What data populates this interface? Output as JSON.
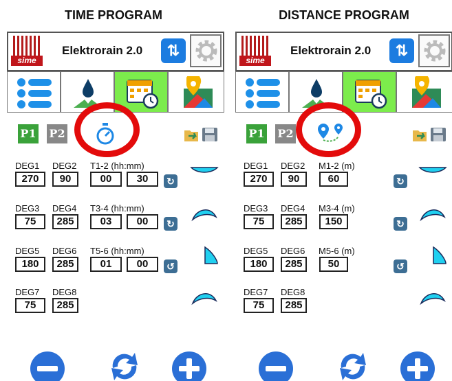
{
  "headings": {
    "left": "TIME PROGRAM",
    "right": "DISTANCE PROGRAM"
  },
  "panels": [
    {
      "app_title": "Elektrorain 2.0",
      "logo_text": "sime",
      "program_buttons": [
        "P1",
        "P2"
      ],
      "mode_icon": "stopwatch-icon",
      "rows": [
        {
          "labels": [
            "DEG1",
            "DEG2",
            "T1-2 (hh:mm)"
          ],
          "deg_a": "270",
          "deg_b": "90",
          "values": [
            "00",
            "30"
          ],
          "reset": "refresh-icon"
        },
        {
          "labels": [
            "DEG3",
            "DEG4",
            "T3-4 (hh:mm)"
          ],
          "deg_a": "75",
          "deg_b": "285",
          "values": [
            "03",
            "00"
          ],
          "reset": "refresh-icon"
        },
        {
          "labels": [
            "DEG5",
            "DEG6",
            "T5-6 (hh:mm)"
          ],
          "deg_a": "180",
          "deg_b": "285",
          "values": [
            "01",
            "00"
          ],
          "reset": "rotate-icon"
        },
        {
          "labels": [
            "DEG7",
            "DEG8",
            ""
          ],
          "deg_a": "75",
          "deg_b": "285",
          "values": [],
          "reset": ""
        }
      ]
    },
    {
      "app_title": "Elektrorain 2.0",
      "logo_text": "sime",
      "program_buttons": [
        "P1",
        "P2"
      ],
      "mode_icon": "distance-route-icon",
      "rows": [
        {
          "labels": [
            "DEG1",
            "DEG2",
            "M1-2 (m)"
          ],
          "deg_a": "270",
          "deg_b": "90",
          "values": [
            "60"
          ],
          "reset": "refresh-icon"
        },
        {
          "labels": [
            "DEG3",
            "DEG4",
            "M3-4 (m)"
          ],
          "deg_a": "75",
          "deg_b": "285",
          "values": [
            "150"
          ],
          "reset": "refresh-icon"
        },
        {
          "labels": [
            "DEG5",
            "DEG6",
            "M5-6 (m)"
          ],
          "deg_a": "180",
          "deg_b": "285",
          "values": [
            "50"
          ],
          "reset": "rotate-icon"
        },
        {
          "labels": [
            "DEG7",
            "DEG8",
            ""
          ],
          "deg_a": "75",
          "deg_b": "285",
          "values": [],
          "reset": ""
        }
      ]
    }
  ],
  "colors": {
    "accent_blue": "#2a6fd6",
    "active_tab": "#7cec4c",
    "highlight_circle": "#e30b0b",
    "sector_fill": "#20d0f0"
  }
}
